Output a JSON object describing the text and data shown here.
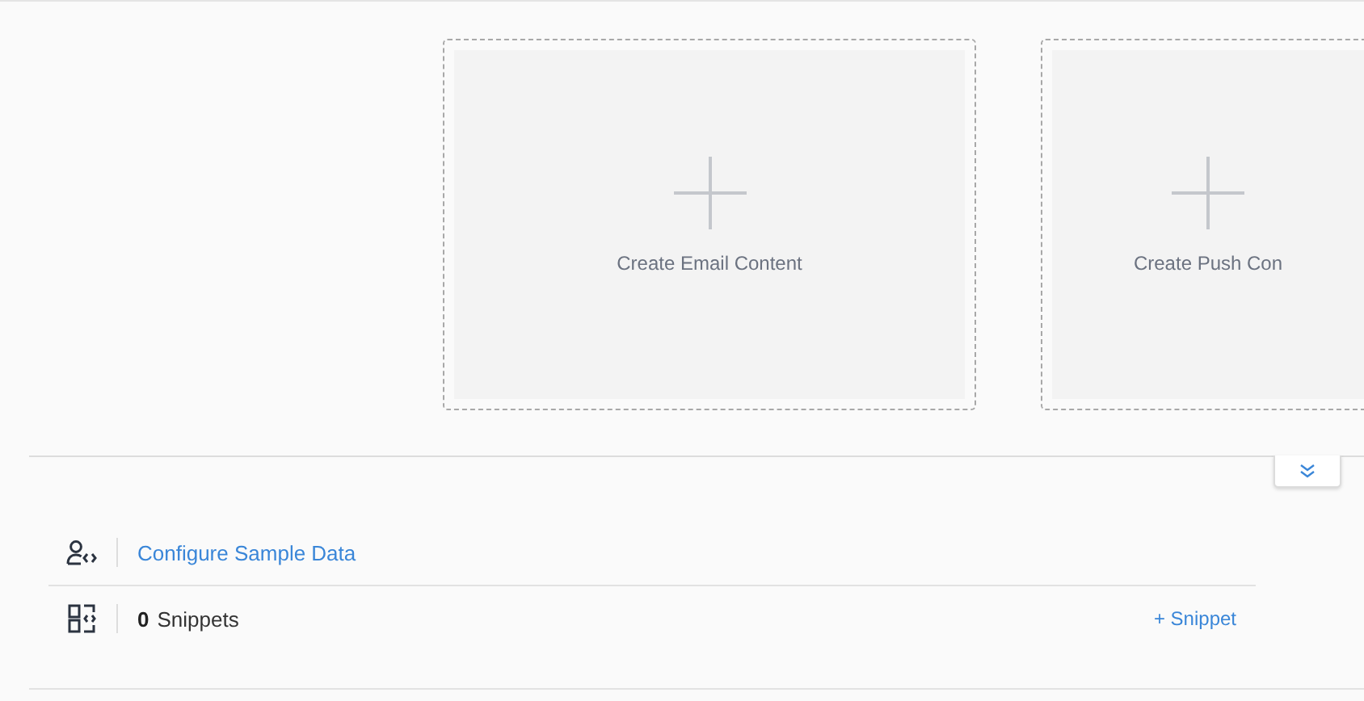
{
  "content_cards": [
    {
      "label": "Create Email Content"
    },
    {
      "label": "Create Push Con"
    }
  ],
  "sample_data": {
    "link": "Configure Sample Data"
  },
  "snippets": {
    "count": "0",
    "label": "Snippets",
    "add": "+ Snippet"
  }
}
